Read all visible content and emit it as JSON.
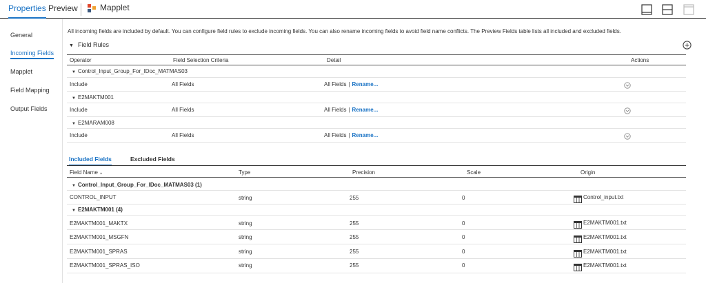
{
  "top": {
    "tabs": [
      {
        "label": "Properties",
        "active": true
      },
      {
        "label": "Preview",
        "active": false
      }
    ],
    "object_title": "Mapplet",
    "icon_colors": {
      "a": "#e0452b",
      "b": "#3d5a80",
      "c": "#f0a030"
    }
  },
  "sidebar": {
    "items": [
      {
        "label": "General"
      },
      {
        "label": "Incoming Fields",
        "active": true
      },
      {
        "label": "Mapplet"
      },
      {
        "label": "Field Mapping"
      },
      {
        "label": "Output Fields"
      }
    ]
  },
  "main": {
    "info": "All incoming fields are included by default. You can configure field rules to exclude incoming fields. You can also rename incoming fields to avoid field name conflicts. The Preview Fields table lists all included and excluded fields.",
    "field_rules_label": "Field Rules",
    "rules_table": {
      "headers": [
        "Operator",
        "Field Selection Criteria",
        "Detail",
        "Actions"
      ],
      "groups": [
        {
          "name": "Control_Input_Group_For_IDoc_MATMAS03",
          "operator": "Include",
          "criteria": "All Fields",
          "detail": "All Fields",
          "link": "Rename..."
        },
        {
          "name": "E2MAKTM001",
          "operator": "Include",
          "criteria": "All Fields",
          "detail": "All Fields",
          "link": "Rename..."
        },
        {
          "name": "E2MARAM008",
          "operator": "Include",
          "criteria": "All Fields",
          "detail": "All Fields",
          "link": "Rename..."
        }
      ]
    },
    "field_tabs": [
      "Included Fields",
      "Excluded Fields"
    ],
    "fields_table": {
      "headers": [
        "Field Name",
        "Type",
        "Precision",
        "Scale",
        "Origin"
      ],
      "sort_indicator": "▲",
      "groups": [
        {
          "name": "Control_Input_Group_For_IDoc_MATMAS03 (1)",
          "rows": [
            {
              "name": "CONTROL_INPUT",
              "type": "string",
              "precision": "255",
              "scale": "0",
              "origin": "Control_input.txt"
            }
          ]
        },
        {
          "name": "E2MAKTM001 (4)",
          "rows": [
            {
              "name": "E2MAKTM001_MAKTX",
              "type": "string",
              "precision": "255",
              "scale": "0",
              "origin": "E2MAKTM001.txt"
            },
            {
              "name": "E2MAKTM001_MSGFN",
              "type": "string",
              "precision": "255",
              "scale": "0",
              "origin": "E2MAKTM001.txt"
            },
            {
              "name": "E2MAKTM001_SPRAS",
              "type": "string",
              "precision": "255",
              "scale": "0",
              "origin": "E2MAKTM001.txt"
            },
            {
              "name": "E2MAKTM001_SPRAS_ISO",
              "type": "string",
              "precision": "255",
              "scale": "0",
              "origin": "E2MAKTM001.txt"
            }
          ]
        }
      ]
    },
    "accent_color": "#1a73c5"
  }
}
